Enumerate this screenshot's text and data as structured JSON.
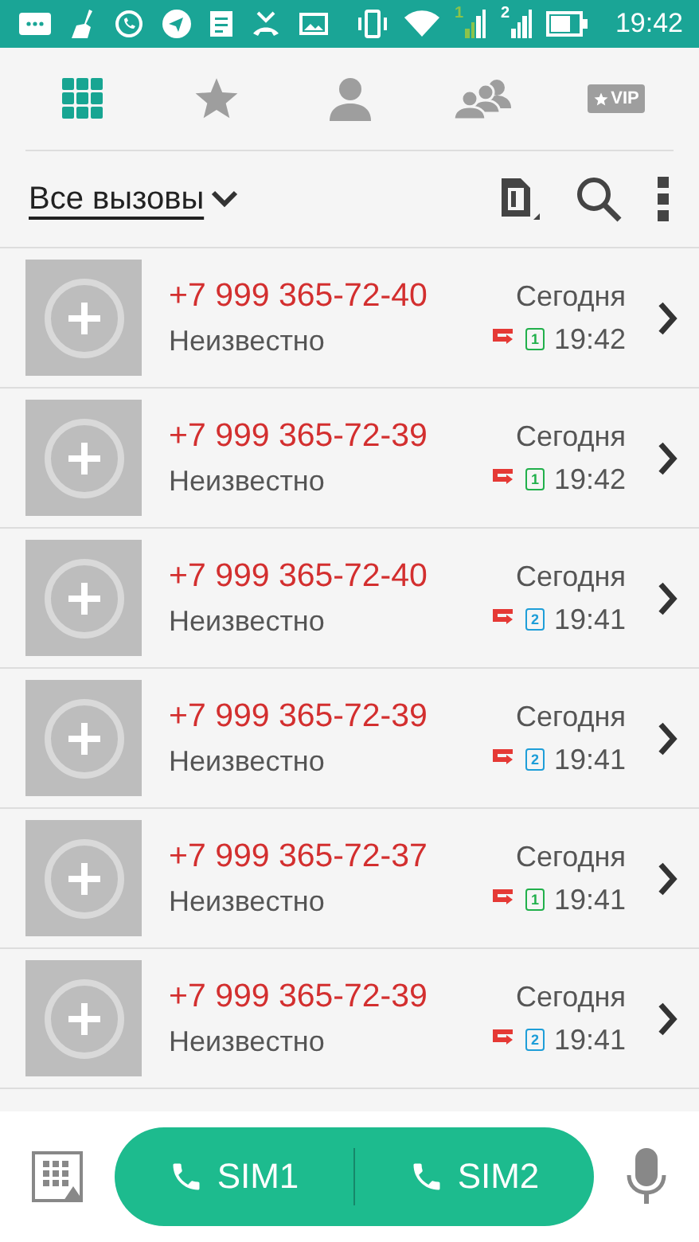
{
  "status_bar": {
    "sim_signals": [
      {
        "label": "1",
        "color": "#8bc34a"
      },
      {
        "label": "2",
        "color": "#ffffff"
      }
    ],
    "time": "19:42"
  },
  "tabs": [
    {
      "kind": "dialpad",
      "selected": true
    },
    {
      "kind": "favorites",
      "selected": false
    },
    {
      "kind": "contacts",
      "selected": false
    },
    {
      "kind": "groups",
      "selected": false
    },
    {
      "kind": "vip",
      "label": "VIP",
      "selected": false
    }
  ],
  "filter": {
    "label": "Все вызовы"
  },
  "calls": [
    {
      "number": "+7 999 365-72-40",
      "name": "Неизвестно",
      "day": "Сегодня",
      "time": "19:42",
      "sim": "1",
      "color": "#21b04b"
    },
    {
      "number": "+7 999 365-72-39",
      "name": "Неизвестно",
      "day": "Сегодня",
      "time": "19:42",
      "sim": "1",
      "color": "#21b04b"
    },
    {
      "number": "+7 999 365-72-40",
      "name": "Неизвестно",
      "day": "Сегодня",
      "time": "19:41",
      "sim": "2",
      "color": "#1e9ed8"
    },
    {
      "number": "+7 999 365-72-39",
      "name": "Неизвестно",
      "day": "Сегодня",
      "time": "19:41",
      "sim": "2",
      "color": "#1e9ed8"
    },
    {
      "number": "+7 999 365-72-37",
      "name": "Неизвестно",
      "day": "Сегодня",
      "time": "19:41",
      "sim": "1",
      "color": "#21b04b"
    },
    {
      "number": "+7 999 365-72-39",
      "name": "Неизвестно",
      "day": "Сегодня",
      "time": "19:41",
      "sim": "2",
      "color": "#1e9ed8"
    }
  ],
  "call_buttons": [
    {
      "label": "SIM1"
    },
    {
      "label": "SIM2"
    }
  ]
}
